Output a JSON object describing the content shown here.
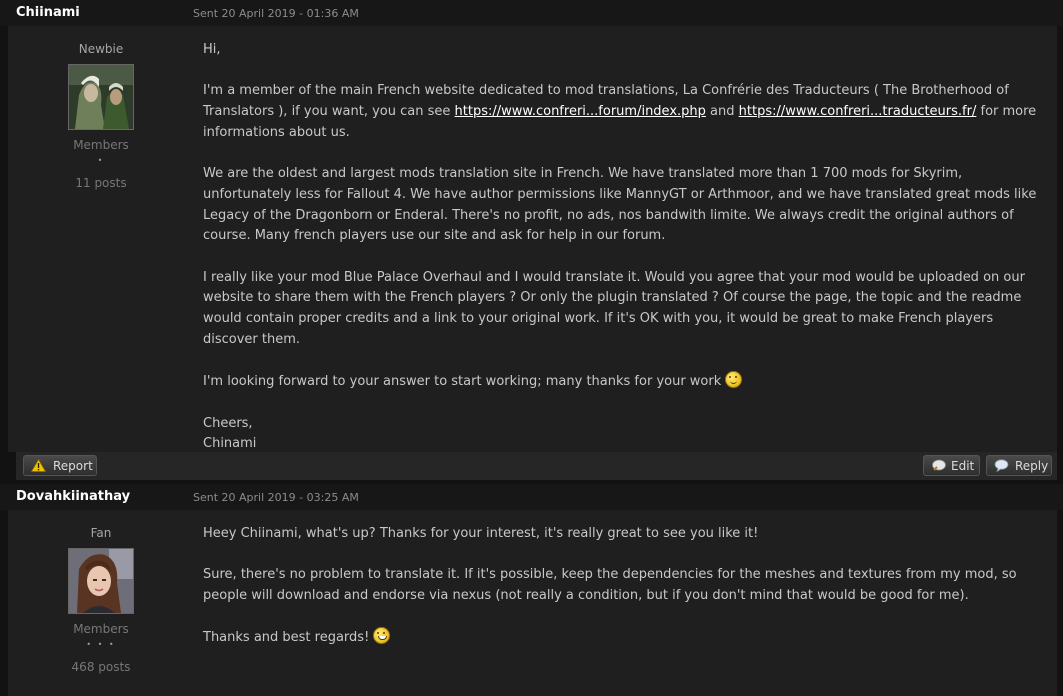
{
  "posts": [
    {
      "author": "Chiinami",
      "date": "Sent 20 April 2019 - 01:36 AM",
      "rank": "Newbie",
      "group": "Members",
      "pips": "•",
      "post_count": "11 posts",
      "content": {
        "greeting": "Hi,",
        "p2_text": "I'm a member of the main French website dedicated to mod translations, La Confrérie des Traducteurs ( The Brotherhood of Translators ), if you want, you can see",
        "link1": "https://www.confreri...forum/index.php",
        "and": "and",
        "link2": "https://www.confreri...traducteurs.fr/",
        "p2_tail": "for more informations about us.",
        "p3": "We are the oldest and largest mods translation site in French. We have translated more than 1 700 mods for Skyrim, unfortunately less for Fallout 4. We have author permissions like MannyGT or Arthmoor, and we have translated great mods like Legacy of the Dragonborn or Enderal. There's no profit, no ads, nos bandwith limite. We always credit the original authors of course. Many french players use our site and ask for help in our forum.",
        "p4": "I really like your mod Blue Palace Overhaul and I would translate it. Would you agree that your mod would be uploaded on our website to share them with the French players ? Or only the plugin translated ? Of course the page, the topic and the readme would contain proper credits and a link to your original work. If it's OK with you, it would be great to make French players discover them.",
        "p5": "I'm looking forward to your answer to start working; many thanks for your work",
        "sign1": "Cheers,",
        "sign2": "Chinami"
      },
      "buttons": {
        "report": "Report",
        "edit": "Edit",
        "reply": "Reply"
      }
    },
    {
      "author": "Dovahkiinathay",
      "date": "Sent 20 April 2019 - 03:25 AM",
      "rank": "Fan",
      "group": "Members",
      "pips": "• • •",
      "post_count": "468 posts",
      "content": {
        "p1": "Heey Chiinami, what's up? Thanks for your interest, it's really great to see you like it!",
        "p2": "Sure, there's no problem to translate it. If it's possible, keep the dependencies for the meshes and textures from my mod, so people will download and endorse via nexus (not really a condition, but if you don't mind that would be good for me).",
        "p3": "Thanks and best regards!"
      }
    }
  ],
  "icons": {
    "report": "warning-icon",
    "edit": "edit-icon",
    "reply": "reply-icon",
    "smiley1": "smiley-icon",
    "smiley2": "grin-icon"
  }
}
